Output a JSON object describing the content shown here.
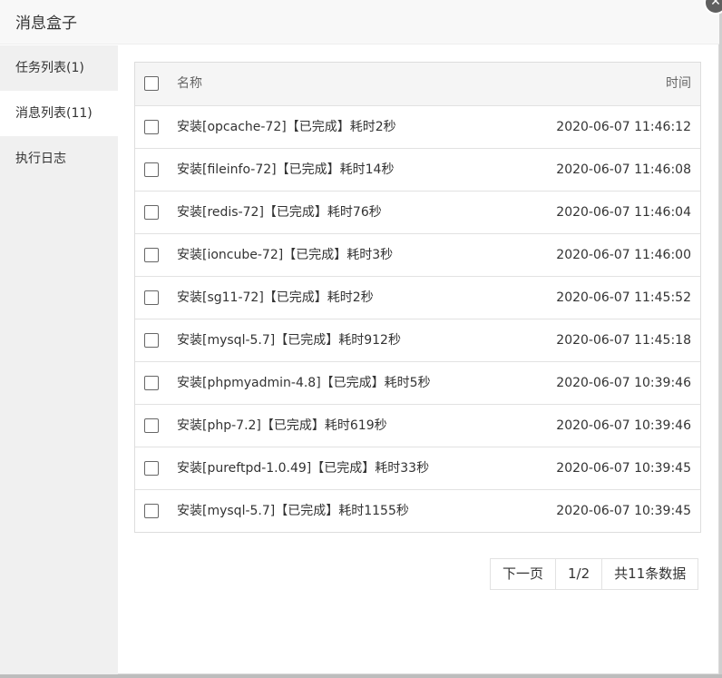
{
  "window": {
    "title": "消息盒子",
    "close_icon": "close-icon"
  },
  "sidebar": {
    "items": [
      {
        "label": "任务列表(1)",
        "active": false
      },
      {
        "label": "消息列表(11)",
        "active": true
      },
      {
        "label": "执行日志",
        "active": false
      }
    ]
  },
  "table": {
    "columns": [
      "名称",
      "时间"
    ],
    "rows": [
      {
        "name": "安装[opcache-72]【已完成】耗时2秒",
        "time": "2020-06-07 11:46:12"
      },
      {
        "name": "安装[fileinfo-72]【已完成】耗时14秒",
        "time": "2020-06-07 11:46:08"
      },
      {
        "name": "安装[redis-72]【已完成】耗时76秒",
        "time": "2020-06-07 11:46:04"
      },
      {
        "name": "安装[ioncube-72]【已完成】耗时3秒",
        "time": "2020-06-07 11:46:00"
      },
      {
        "name": "安装[sg11-72]【已完成】耗时2秒",
        "time": "2020-06-07 11:45:52"
      },
      {
        "name": "安装[mysql-5.7]【已完成】耗时912秒",
        "time": "2020-06-07 11:45:18"
      },
      {
        "name": "安装[phpmyadmin-4.8]【已完成】耗时5秒",
        "time": "2020-06-07 10:39:46"
      },
      {
        "name": "安装[php-7.2]【已完成】耗时619秒",
        "time": "2020-06-07 10:39:46"
      },
      {
        "name": "安装[pureftpd-1.0.49]【已完成】耗时33秒",
        "time": "2020-06-07 10:39:45"
      },
      {
        "name": "安装[mysql-5.7]【已完成】耗时1155秒",
        "time": "2020-06-07 10:39:45"
      }
    ]
  },
  "pager": {
    "next": "下一页",
    "page": "1/2",
    "total": "共11条数据"
  }
}
